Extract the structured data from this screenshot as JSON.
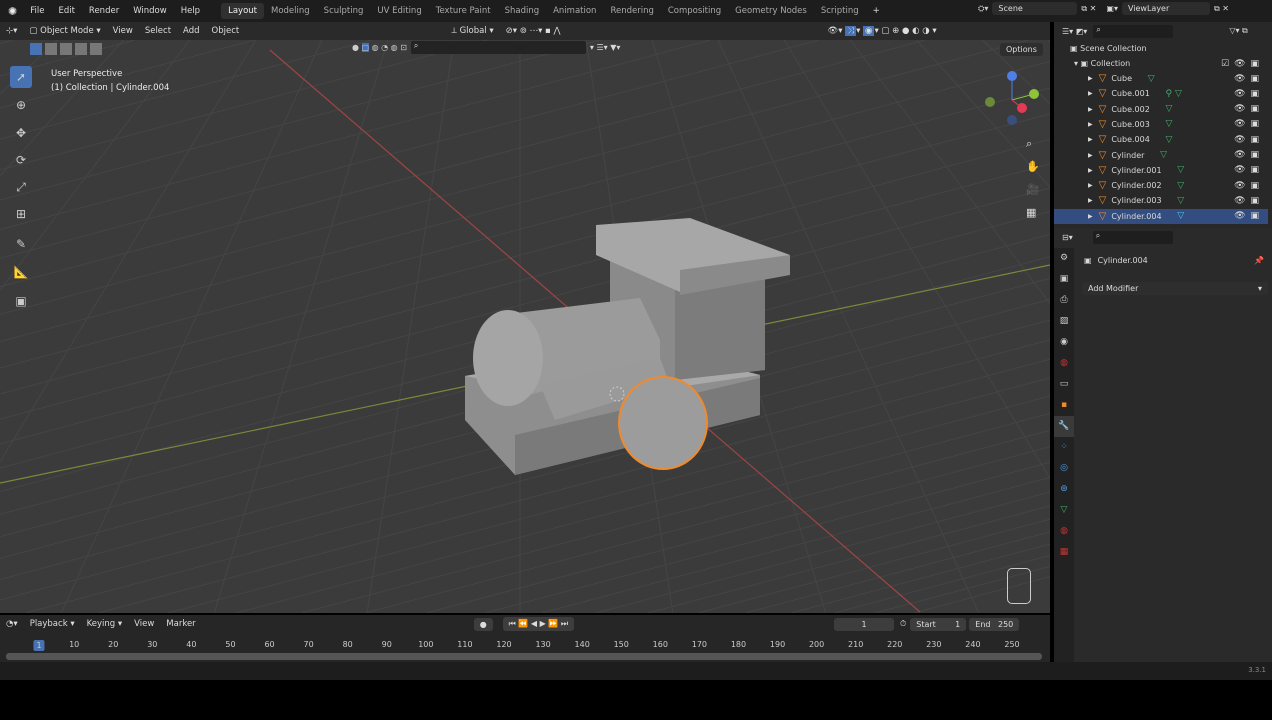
{
  "menu": [
    "File",
    "Edit",
    "Render",
    "Window",
    "Help"
  ],
  "workspaces": [
    "Layout",
    "Modeling",
    "Sculpting",
    "UV Editing",
    "Texture Paint",
    "Shading",
    "Animation",
    "Rendering",
    "Compositing",
    "Geometry Nodes",
    "Scripting"
  ],
  "active_workspace": "Layout",
  "scene": "Scene",
  "view_layer": "ViewLayer",
  "viewport_header": {
    "mode": "Object Mode",
    "menus": [
      "View",
      "Select",
      "Add",
      "Object"
    ],
    "orientation": "Global",
    "options": "Options"
  },
  "overlay": {
    "perspective": "User Perspective",
    "context": "(1) Collection | Cylinder.004"
  },
  "outliner": {
    "root": "Scene Collection",
    "collection": "Collection",
    "items": [
      "Cube",
      "Cube.001",
      "Cube.002",
      "Cube.003",
      "Cube.004",
      "Cylinder",
      "Cylinder.001",
      "Cylinder.002",
      "Cylinder.003",
      "Cylinder.004"
    ],
    "selected": "Cylinder.004"
  },
  "properties": {
    "object": "Cylinder.004",
    "add_modifier": "Add Modifier"
  },
  "timeline": {
    "menus": [
      "Playback",
      "Keying",
      "View",
      "Marker"
    ],
    "current_frame": "1",
    "start_label": "Start",
    "start": "1",
    "end_label": "End",
    "end": "250",
    "ticks": [
      "1",
      "10",
      "20",
      "30",
      "40",
      "50",
      "60",
      "70",
      "80",
      "90",
      "100",
      "110",
      "120",
      "130",
      "140",
      "150",
      "160",
      "170",
      "180",
      "190",
      "200",
      "210",
      "220",
      "230",
      "240",
      "250"
    ]
  },
  "version": "3.3.1",
  "colors": {
    "selected": "#334d80",
    "accent": "#4772b3",
    "orange": "#f08a2c",
    "mesh": "#3fb06b"
  }
}
